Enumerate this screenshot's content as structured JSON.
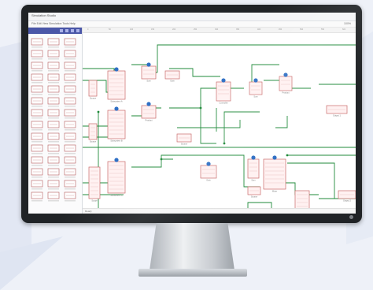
{
  "window": {
    "title": "Simulation Studio",
    "menu": "File  Edit  View  Simulation  Tools  Help",
    "zoom": "100%"
  },
  "canvas": {
    "status": "Ready",
    "ruler_ticks": [
      "0",
      "50",
      "100",
      "150",
      "200",
      "250",
      "300",
      "350",
      "400",
      "450",
      "500",
      "550",
      "600"
    ]
  },
  "blocks": [
    {
      "label": "Subsystem A",
      "kind": "subsystem"
    },
    {
      "label": "Subsystem B",
      "kind": "subsystem"
    },
    {
      "label": "Subsystem C",
      "kind": "subsystem"
    },
    {
      "label": "Controller",
      "kind": "subsystem"
    },
    {
      "label": "Mixer",
      "kind": "subsystem"
    },
    {
      "label": "Sum",
      "kind": "op"
    },
    {
      "label": "Product",
      "kind": "op"
    },
    {
      "label": "Gain",
      "kind": "op"
    },
    {
      "label": "Output 1",
      "kind": "out"
    },
    {
      "label": "Output 2",
      "kind": "out"
    },
    {
      "label": "Scope",
      "kind": "out"
    },
    {
      "label": "Source",
      "kind": "in"
    }
  ],
  "colors": {
    "wire": "#1f8a3a",
    "block_border": "#c86a6a",
    "block_fill": "#fff1f1",
    "badge": "#2f6fc4",
    "sidebar_header": "#4b57a8",
    "bezel": "#202326"
  }
}
